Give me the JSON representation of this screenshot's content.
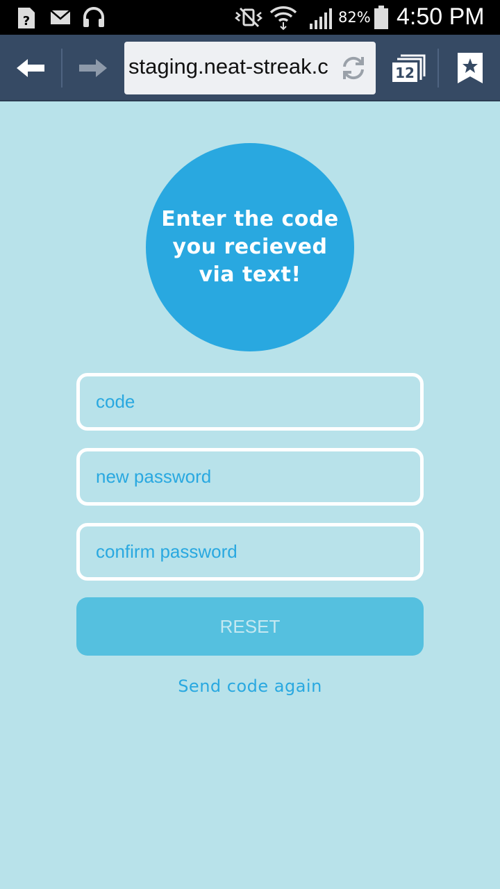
{
  "status_bar": {
    "battery_percent": "82%",
    "time": "4:50 PM",
    "icons": [
      "unknown-file-icon",
      "mail-icon",
      "headphones-icon",
      "vibrate-mute-icon",
      "wifi-icon",
      "signal-icon",
      "battery-icon"
    ]
  },
  "browser": {
    "url": "staging.neat-streak.c",
    "tab_count": "12",
    "icons": [
      "back-arrow-icon",
      "forward-arrow-icon",
      "reload-icon",
      "tabs-icon",
      "bookmark-icon"
    ]
  },
  "page": {
    "prompt": "Enter the code you recieved via text!",
    "fields": {
      "code_placeholder": "code",
      "new_password_placeholder": "new password",
      "confirm_password_placeholder": "confirm password"
    },
    "reset_label": "RESET",
    "resend_label": "Send code again"
  },
  "colors": {
    "background": "#b8e2ea",
    "accent": "#29a8e0",
    "button": "#55c0df",
    "toolbar": "#364a64"
  }
}
